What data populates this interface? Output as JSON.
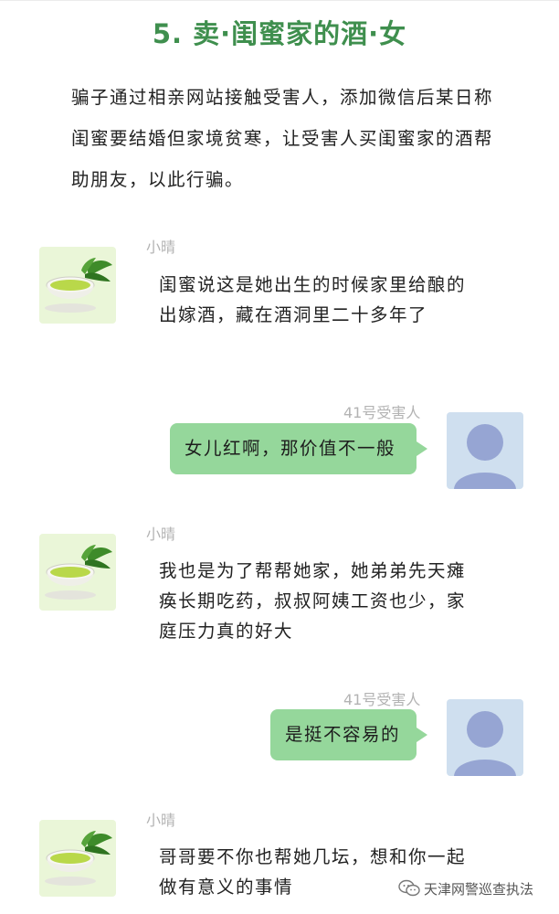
{
  "article": {
    "title": "5. 卖·闺蜜家的酒·女",
    "intro": "骗子通过相亲网站接触受害人，添加微信后某日称闺蜜要结婚但家境贫寒，让受害人买闺蜜家的酒帮助朋友，以此行骗。"
  },
  "chat": {
    "scammer_name": "小晴",
    "victim_name": "41号受害人",
    "messages": [
      {
        "sender": "小晴",
        "text": "闺蜜说这是她出生的时候家里给酿的出嫁酒，藏在酒洞里二十多年了"
      },
      {
        "sender": "41号受害人",
        "text": "女儿红啊，那价值不一般"
      },
      {
        "sender": "小晴",
        "text": "我也是为了帮帮她家，她弟弟先天瘫痪长期吃药，叔叔阿姨工资也少，家庭压力真的好大"
      },
      {
        "sender": "41号受害人",
        "text": "是挺不容易的"
      },
      {
        "sender": "小晴",
        "text": "哥哥要不你也帮她几坛，想和你一起做有意义的事情"
      }
    ]
  },
  "watermark": {
    "text": "天津网警巡查执法",
    "icon": "wechat-icon"
  },
  "colors": {
    "title": "#3f8f4e",
    "bubble_outgoing": "#95d79b",
    "sender_name": "#b3b3b3",
    "tea_avatar_bg": "#eaf6d8",
    "user_avatar_bg": "#cfdfef"
  }
}
